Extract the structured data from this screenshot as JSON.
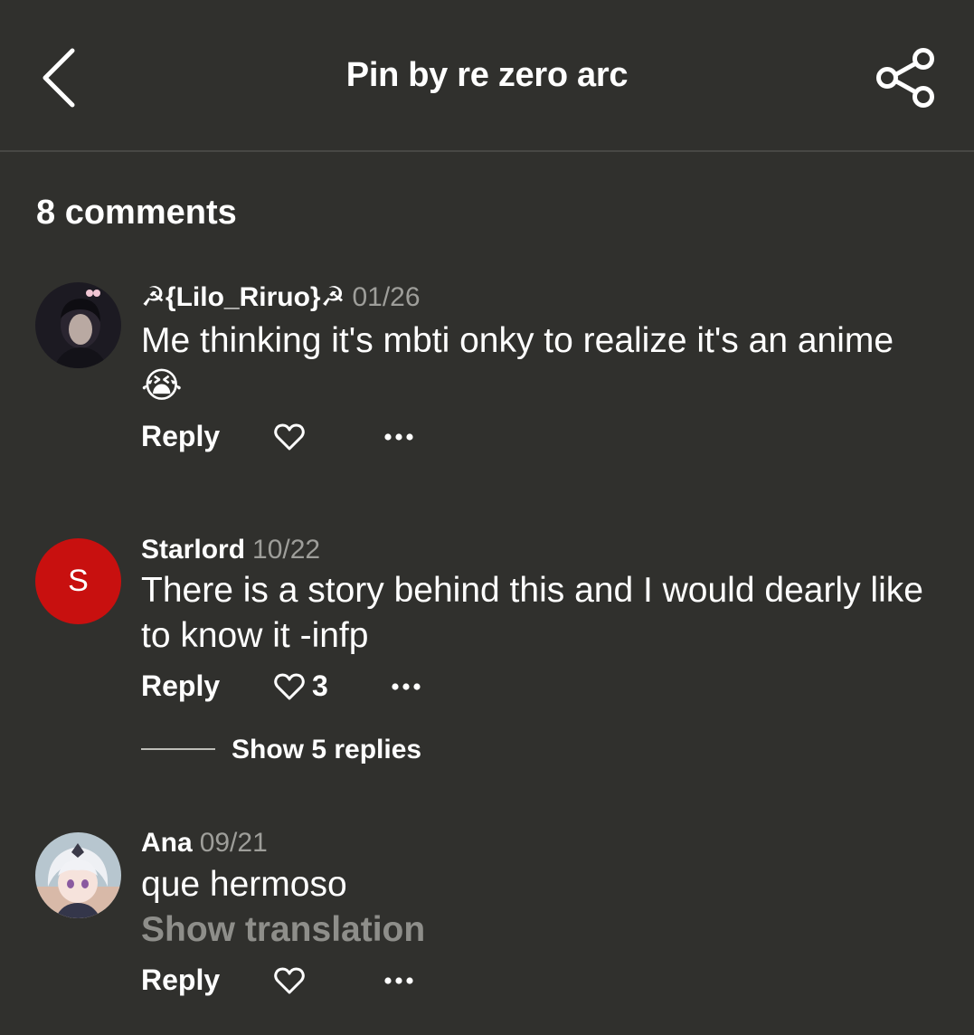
{
  "header": {
    "title": "Pin by re zero arc",
    "back_icon": "chevron-left-icon",
    "share_icon": "share-icon"
  },
  "comments_count": "8 comments",
  "comments": [
    {
      "author": "☭{Lilo_Riruo}☭",
      "date": "01/26",
      "body": "Me thinking it's mbti onky to realize it's an anime 😭",
      "reply_label": "Reply",
      "likes": ""
    },
    {
      "author": "Starlord",
      "avatar_letter": "S",
      "date": "10/22",
      "body": "There is a story behind this and I would dearly like to know it -infp",
      "reply_label": "Reply",
      "likes": "3",
      "show_replies": "Show 5 replies"
    },
    {
      "author": "Ana",
      "date": "09/21",
      "body": "que hermoso",
      "translate_label": "Show translation",
      "reply_label": "Reply",
      "likes": ""
    }
  ],
  "colors": {
    "background": "#30302d",
    "text": "#ffffff",
    "muted": "#9e9e9a",
    "avatar_red": "#c8100f"
  }
}
